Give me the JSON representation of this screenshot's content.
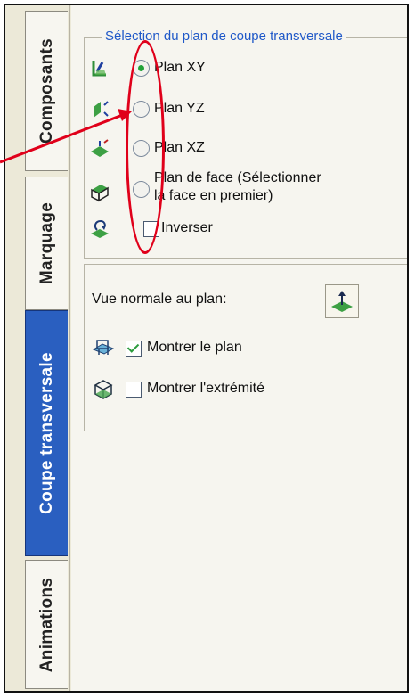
{
  "tabs": [
    {
      "label": "Composants",
      "active": false
    },
    {
      "label": "Marquage",
      "active": false
    },
    {
      "label": "Coupe transversale",
      "active": true
    },
    {
      "label": "Animations",
      "active": false
    }
  ],
  "plane_selection": {
    "legend": "Sélection du plan de coupe transversale",
    "options": [
      {
        "label": "Plan XY",
        "selected": true,
        "icon": "plane-xy-icon"
      },
      {
        "label": "Plan YZ",
        "selected": false,
        "icon": "plane-yz-icon"
      },
      {
        "label": "Plan XZ",
        "selected": false,
        "icon": "plane-xz-icon"
      },
      {
        "label_line1": "Plan de face (Sélectionner",
        "label_line2": "la face en premier)",
        "selected": false,
        "icon": "plane-face-icon"
      }
    ],
    "invert": {
      "label": "Inverser",
      "checked": false,
      "icon": "invert-icon"
    }
  },
  "view_options": {
    "normal_view_label": "Vue normale au plan:",
    "show_plane": {
      "label": "Montrer le plan",
      "checked": true,
      "icon": "show-plane-icon"
    },
    "show_end": {
      "label": "Montrer l'extrémité",
      "checked": false,
      "icon": "show-end-icon"
    }
  },
  "colors": {
    "active_tab": "#2a5fc0",
    "legend_text": "#1f58c8",
    "annotation": "#e0001a",
    "radio_selected": "#23a33a"
  }
}
